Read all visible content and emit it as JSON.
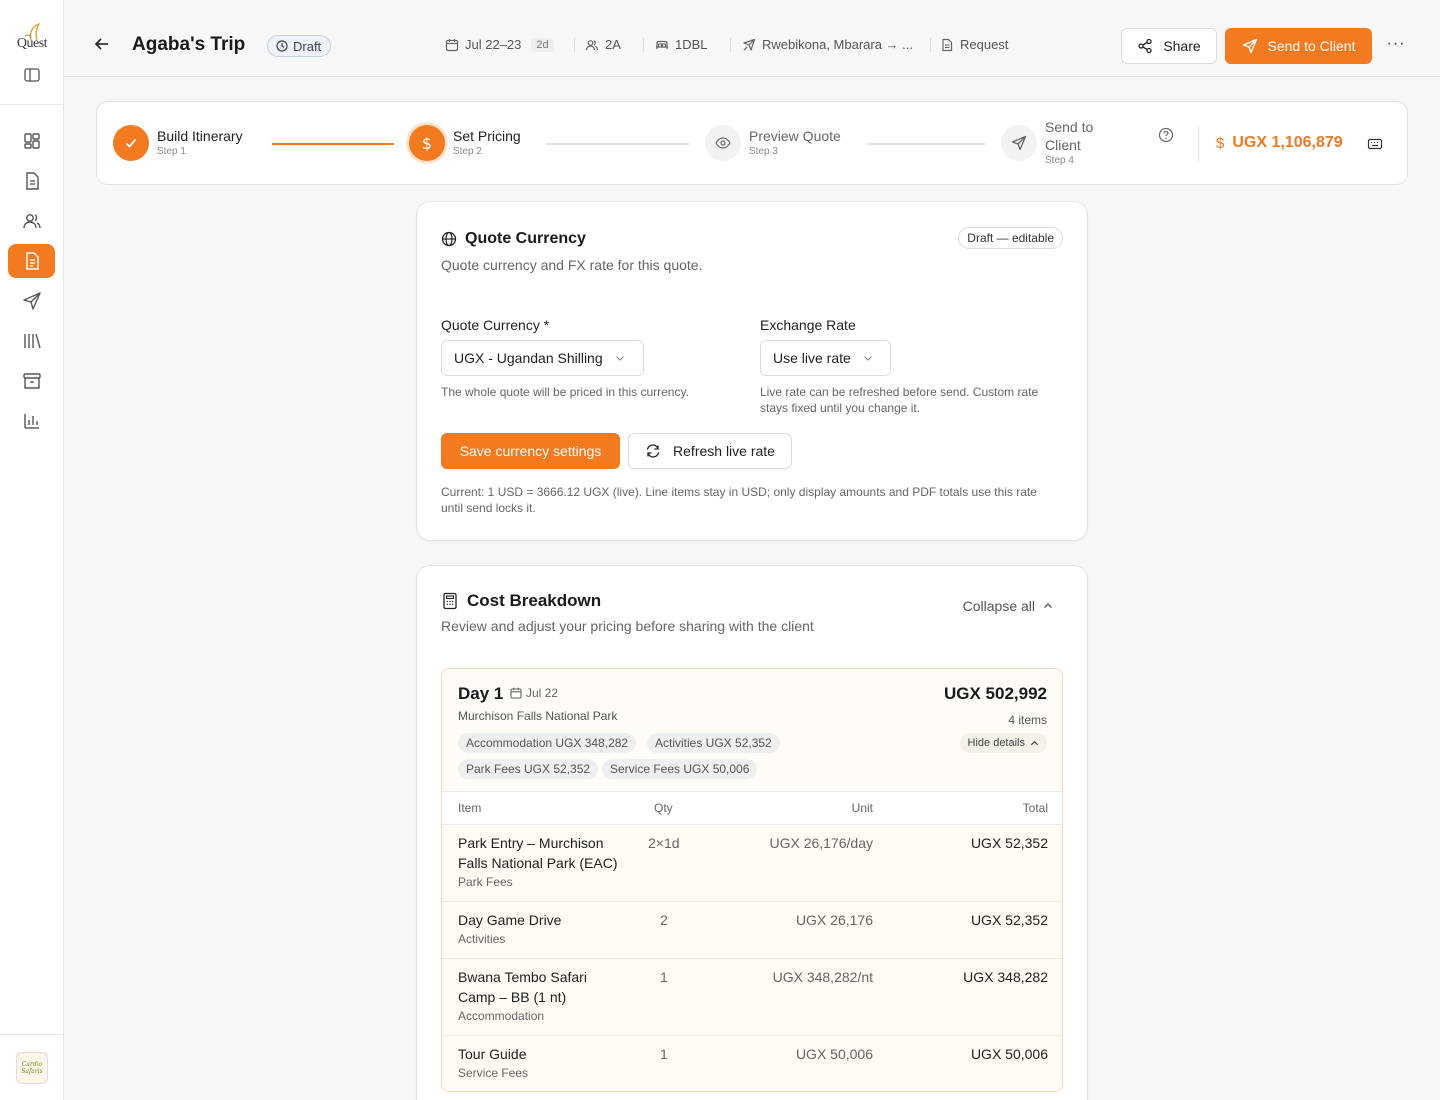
{
  "brand": {
    "logo_text": "Quest",
    "accent": "#f47a20",
    "org_avatar_text": "Cardio Safaris"
  },
  "sidebar": {
    "items": [
      {
        "name": "dashboard-icon",
        "active": false
      },
      {
        "name": "document-icon",
        "active": false
      },
      {
        "name": "users-icon",
        "active": false
      },
      {
        "name": "quote-icon",
        "active": true
      },
      {
        "name": "send-icon",
        "active": false
      },
      {
        "name": "library-icon",
        "active": false
      },
      {
        "name": "archive-icon",
        "active": false
      },
      {
        "name": "chart-icon",
        "active": false
      }
    ]
  },
  "header": {
    "title": "Agaba's Trip",
    "status": "Draft",
    "dates": "Jul 22–23",
    "duration": "2d",
    "travellers": "2A",
    "rooms": "1DBL",
    "route": "Rwebikona, Mbarara → ...",
    "request": "Request",
    "share_label": "Share",
    "send_label": "Send to Client",
    "more_label": "···"
  },
  "stepper": {
    "steps": [
      {
        "label": "Build Itinerary",
        "sub": "Step 1",
        "state": "done"
      },
      {
        "label": "Set Pricing",
        "sub": "Step 2",
        "state": "current"
      },
      {
        "label": "Preview Quote",
        "sub": "Step 3",
        "state": "todo"
      },
      {
        "label": "Send to",
        "label2": "Client",
        "sub": "Step 4",
        "state": "todo"
      }
    ],
    "total": "UGX 1,106,879",
    "total_symbol": "$"
  },
  "currency_card": {
    "title": "Quote Currency",
    "badge": "Draft — editable",
    "subtitle": "Quote currency and FX rate for this quote.",
    "currency_label": "Quote Currency *",
    "currency_value": "UGX - Ugandan Shilling",
    "currency_help": "The whole quote will be priced in this currency.",
    "rate_label": "Exchange Rate",
    "rate_value": "Use live rate",
    "rate_help_1": "Live rate can be refreshed before send. Custom rate",
    "rate_help_2": "stays fixed until you change it.",
    "save_label": "Save currency settings",
    "refresh_label": "Refresh live rate",
    "note_1": "Current: 1 USD = 3666.12 UGX (live). Line items stay in USD; only display amounts and PDF totals use this rate",
    "note_2": "until send locks it."
  },
  "breakdown": {
    "title": "Cost Breakdown",
    "subtitle": "Review and adjust your pricing before sharing with the client",
    "collapse_label": "Collapse all",
    "day": {
      "title": "Day 1",
      "date": "Jul 22",
      "place": "Murchison Falls National Park",
      "total": "UGX 502,992",
      "count": "4 items",
      "hide_label": "Hide details",
      "chips": [
        "Accommodation UGX 348,282",
        "Activities UGX 52,352",
        "Park Fees UGX 52,352",
        "Service Fees UGX 50,006"
      ],
      "columns": {
        "item": "Item",
        "qty": "Qty",
        "unit": "Unit",
        "total": "Total"
      },
      "rows": [
        {
          "name_1": "Park Entry – Murchison",
          "name_2": "Falls National Park (EAC)",
          "category": "Park Fees",
          "qty": "2×1d",
          "unit": "UGX 26,176/day",
          "total": "UGX 52,352"
        },
        {
          "name_1": "Day Game Drive",
          "name_2": "",
          "category": "Activities",
          "qty": "2",
          "unit": "UGX 26,176",
          "total": "UGX 52,352"
        },
        {
          "name_1": "Bwana Tembo Safari",
          "name_2": "Camp – BB (1 nt)",
          "category": "Accommodation",
          "qty": "1",
          "unit": "UGX 348,282/nt",
          "total": "UGX 348,282"
        },
        {
          "name_1": "Tour Guide",
          "name_2": "",
          "category": "Service Fees",
          "qty": "1",
          "unit": "UGX 50,006",
          "total": "UGX 50,006"
        }
      ]
    }
  }
}
